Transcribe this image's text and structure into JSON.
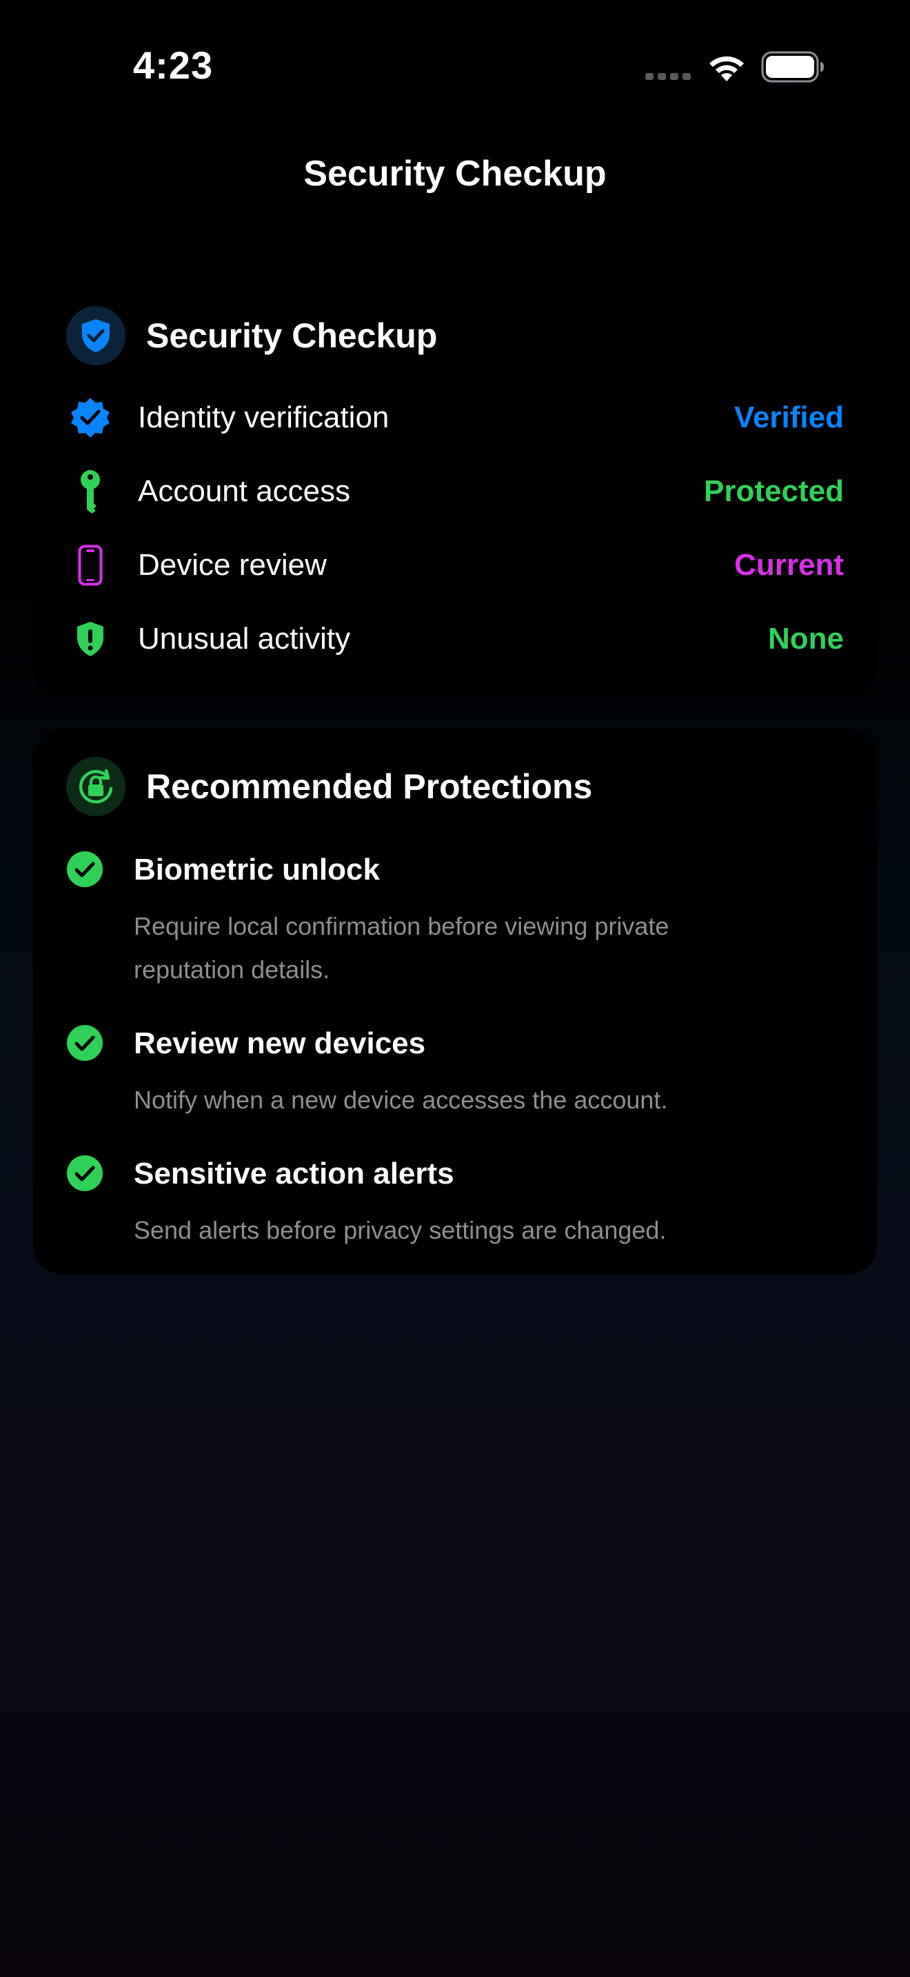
{
  "status_bar": {
    "time": "4:23",
    "icons": [
      "cellular-dots-icon",
      "wifi-icon",
      "battery-icon"
    ]
  },
  "nav": {
    "title": "Security Checkup"
  },
  "security_card": {
    "title": "Security Checkup",
    "header_icon": "checkmark-shield-icon",
    "rows": [
      {
        "label": "Identity verification",
        "value": "Verified",
        "icon": "verified-seal-icon",
        "color": "#0a84ff"
      },
      {
        "label": "Account access",
        "value": "Protected",
        "icon": "key-icon",
        "color": "#30d158"
      },
      {
        "label": "Device review",
        "value": "Current",
        "icon": "phone-icon",
        "color": "#d631e6"
      },
      {
        "label": "Unusual activity",
        "value": "None",
        "icon": "exclamation-shield-icon",
        "color": "#30d158"
      }
    ]
  },
  "protections_card": {
    "title": "Recommended Protections",
    "header_icon": "lock-rotation-icon",
    "items": [
      {
        "title": "Biometric unlock",
        "description": "Require local confirmation before viewing private reputation details."
      },
      {
        "title": "Review new devices",
        "description": "Notify when a new device accesses the account."
      },
      {
        "title": "Sensitive action alerts",
        "description": "Send alerts before privacy settings are changed."
      }
    ]
  },
  "colors": {
    "blue": "#0a84ff",
    "green": "#30d158",
    "magenta": "#d631e6",
    "secondary_text": "#8e8e93"
  }
}
